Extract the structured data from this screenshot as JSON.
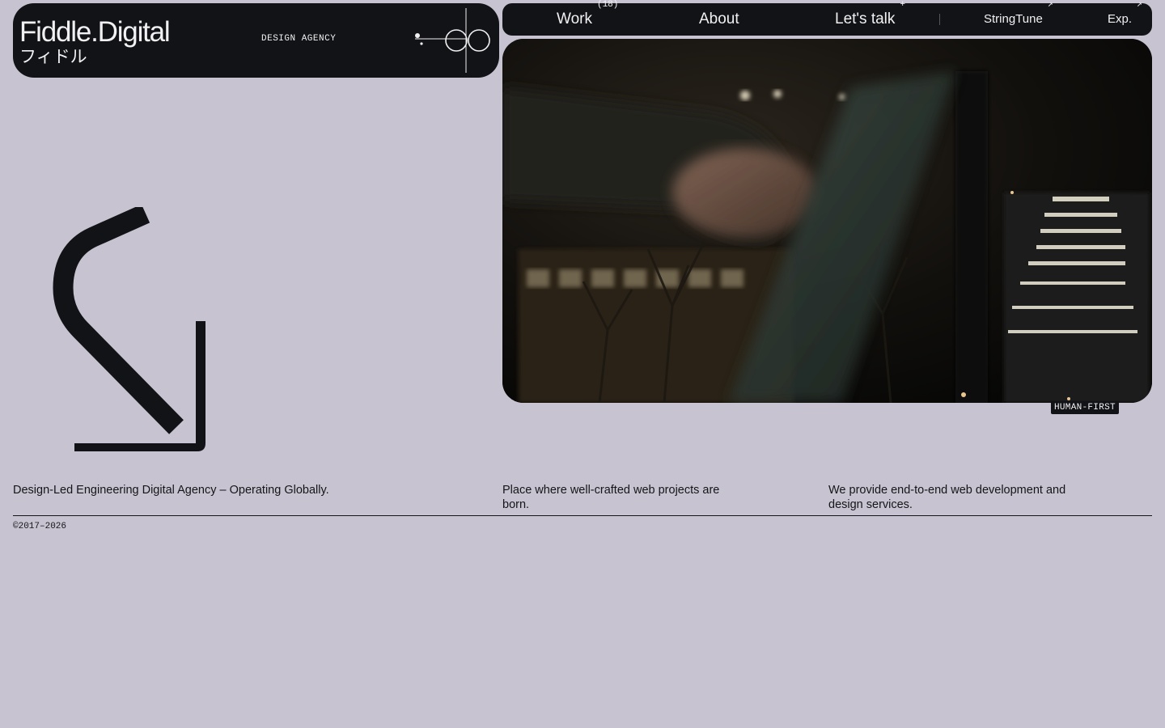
{
  "brand": {
    "name": "Fiddle.Digital",
    "name_jp": "フィドル",
    "tagline": "DESIGN AGENCY",
    "logo_icon": "infinity-link-logo"
  },
  "nav": {
    "items": [
      {
        "label": "Work",
        "sup": "(18)"
      },
      {
        "label": "About",
        "sup": ""
      },
      {
        "label": "Let's talk",
        "sup": "+"
      },
      {
        "label": "StringTune",
        "sup": "↗"
      },
      {
        "label": "Exp.",
        "sup": "↗"
      }
    ]
  },
  "hero": {
    "badge": "HUMAN-FIRST",
    "media_icon": "night-city-video"
  },
  "decor": {
    "arrow_icon": "arrow-down-right-icon"
  },
  "info": {
    "col1": "Design-Led Engineering Digital Agency – Operating Globally.",
    "col2": "Place where well-crafted web projects are born.",
    "col3": "We provide end-to-end web development and design services."
  },
  "footer": {
    "copyright": "©2017–2026"
  },
  "colors": {
    "background": "#c8c3d0",
    "dark": "#121316",
    "light_text": "#f1f1f3"
  }
}
